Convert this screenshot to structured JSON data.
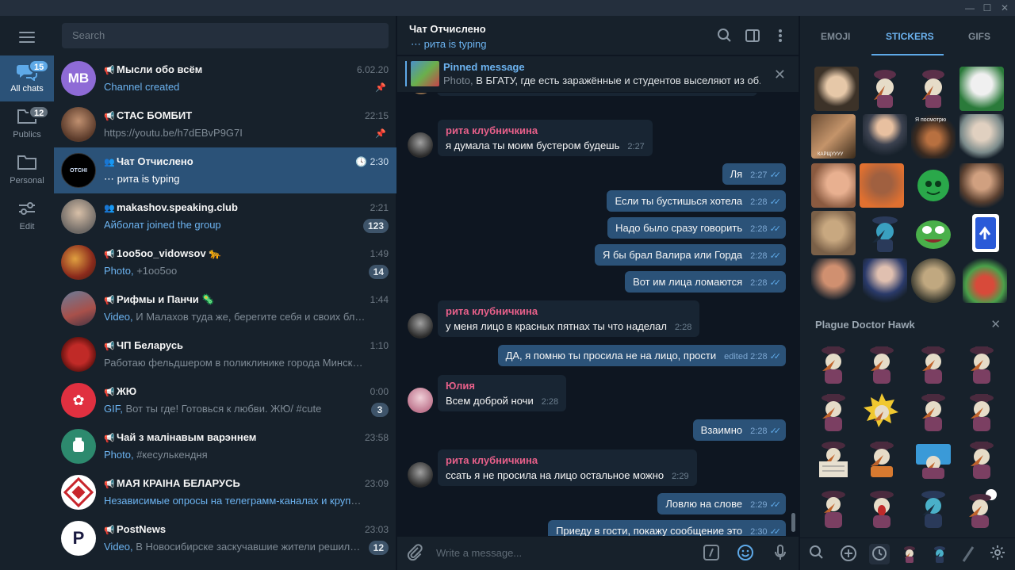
{
  "window": {
    "min_label": "—",
    "max_label": "☐",
    "close_label": "✕"
  },
  "folders": [
    {
      "label": "All chats",
      "badge": "15",
      "icon": "chats-icon",
      "active": true
    },
    {
      "label": "Publics",
      "badge": "12",
      "icon": "folder-icon",
      "active": false
    },
    {
      "label": "Personal",
      "badge": "",
      "icon": "folder-icon",
      "active": false
    },
    {
      "label": "Edit",
      "badge": "",
      "icon": "sliders-icon",
      "active": false
    }
  ],
  "search": {
    "placeholder": "Search"
  },
  "chats": [
    {
      "name": "Мысли обо всём",
      "type": "channel",
      "time": "6.02.20",
      "msg_prefix": "",
      "msg": "Channel created",
      "badge": "",
      "pinned": true,
      "avatar_text": "MB",
      "avatar_color": "#8e6bd6"
    },
    {
      "name": "СТАС БОМБИТ",
      "type": "channel",
      "time": "22:15",
      "msg_prefix": "",
      "msg": "https://youtu.be/h7dEBvP9G7I",
      "badge": "",
      "pinned": true,
      "avatar_text": "",
      "avatar_color": "#6a4e3c"
    },
    {
      "name": "Чат Отчислено",
      "type": "group",
      "time": "2:30",
      "msg_prefix": "",
      "msg": "⋯ рита is typing",
      "badge": "",
      "pinned": false,
      "avatar_text": "OTCHI SLENO",
      "avatar_color": "#000000"
    },
    {
      "name": "makashov.speaking.club",
      "type": "group",
      "time": "2:21",
      "msg_prefix": "",
      "msg": "Айболат joined the group",
      "badge": "123",
      "pinned": false,
      "avatar_text": "",
      "avatar_color": "#8a8a86"
    },
    {
      "name": "1oo5oo_vidowsov 🐆",
      "type": "channel",
      "time": "1:49",
      "msg_prefix": "Photo,",
      "msg": " +1oo5oo",
      "badge": "14",
      "pinned": false,
      "avatar_text": "",
      "avatar_color": "#8b2a1c"
    },
    {
      "name": "Рифмы и Панчи 🦠",
      "type": "channel",
      "time": "1:44",
      "msg_prefix": "Video,",
      "msg": " И Малахов туда же, берегите себя и своих близких, та...",
      "badge": "",
      "pinned": false,
      "avatar_text": "",
      "avatar_color": "#5a4c5c"
    },
    {
      "name": "ЧП Беларусь",
      "type": "channel",
      "time": "1:10",
      "msg_prefix": "",
      "msg": "Работаю фельдшером в поликлинике города Минска. Конт...",
      "badge": "",
      "pinned": false,
      "avatar_text": "",
      "avatar_color": "#c02a27"
    },
    {
      "name": "ЖЮ",
      "type": "channel",
      "time": "0:00",
      "msg_prefix": "GIF,",
      "msg": " Вот ты где! Готовься к любви.  ЖЮ/ #cute",
      "badge": "3",
      "pinned": false,
      "avatar_text": "",
      "avatar_color": "#e03040"
    },
    {
      "name": "Чай з малінавым варэннем",
      "type": "channel",
      "time": "23:58",
      "msg_prefix": "Photo,",
      "msg": " #кесулькендня",
      "badge": "",
      "pinned": false,
      "avatar_text": "",
      "avatar_color": "#2d8a6e"
    },
    {
      "name": "МАЯ КРАІНА БЕЛАРУСЬ",
      "type": "channel",
      "time": "23:09",
      "msg_prefix": "Независимые опросы на телеграмм-каналах и крупнейших...",
      "msg": "",
      "badge": "",
      "pinned": false,
      "avatar_text": "",
      "avatar_color": "#ffffff"
    },
    {
      "name": "PostNews",
      "type": "channel",
      "time": "23:03",
      "msg_prefix": "Video,",
      "msg": " В Новосибирске заскучавшие жители решили за...",
      "badge": "12",
      "pinned": false,
      "avatar_text": "P",
      "avatar_color": "#ffffff"
    }
  ],
  "header": {
    "title": "Чат Отчислено",
    "status": "⋯ рита is typing"
  },
  "pinned": {
    "title": "Pinned message",
    "prefix": "Photo,",
    "text": " В БГАТУ, где есть заражённые и студентов выселяют из об..."
  },
  "messages": [
    {
      "dir": "in",
      "sender": "рита клубничкина",
      "sender_color": "#e8608a",
      "text": "я думала ты моим бустером будешь",
      "time": "2:27"
    },
    {
      "dir": "out",
      "text": "Ля",
      "time": "2:27"
    },
    {
      "dir": "out",
      "text": "Если ты бустишься хотела",
      "time": "2:28"
    },
    {
      "dir": "out",
      "text": "Надо было сразу говорить",
      "time": "2:28"
    },
    {
      "dir": "out",
      "text": "Я бы брал Валира или Горда",
      "time": "2:28"
    },
    {
      "dir": "out",
      "text": "Вот им лица ломаются",
      "time": "2:28"
    },
    {
      "dir": "in",
      "sender": "рита клубничкина",
      "sender_color": "#e8608a",
      "text": "у меня лицо в красных пятнах ты что наделал",
      "time": "2:28"
    },
    {
      "dir": "out",
      "text": "ДА, я помню ты просила не на лицо, прости",
      "time": "edited 2:28"
    },
    {
      "dir": "in",
      "sender": "Юлия",
      "sender_color": "#e8608a",
      "text": "Всем доброй ночи",
      "time": "2:28"
    },
    {
      "dir": "out",
      "text": "Взаимно",
      "time": "2:28"
    },
    {
      "dir": "in",
      "sender": "рита клубничкина",
      "sender_color": "#e8608a",
      "text": "ссать я не просила на лицо остальное можно",
      "time": "2:29"
    },
    {
      "dir": "out",
      "text": "Ловлю на слове",
      "time": "2:29"
    },
    {
      "dir": "out",
      "text": "Приеду в гости, покажу сообщение это",
      "time": "2:30"
    }
  ],
  "composer": {
    "placeholder": "Write a message..."
  },
  "sticker_panel": {
    "tabs": [
      "EMOJI",
      "STICKERS",
      "GIFS"
    ],
    "active_tab": "STICKERS",
    "set_name": "Plague Doctor Hawk",
    "sticker_captions": [
      "КАРЩУУУУ",
      "Я посмотрю"
    ]
  },
  "colors": {
    "accent": "#5ea9e8",
    "selected": "#2b5278",
    "panel": "#17212b",
    "background": "#0e1621",
    "outgoing": "#2b5278",
    "incoming": "#182533"
  }
}
